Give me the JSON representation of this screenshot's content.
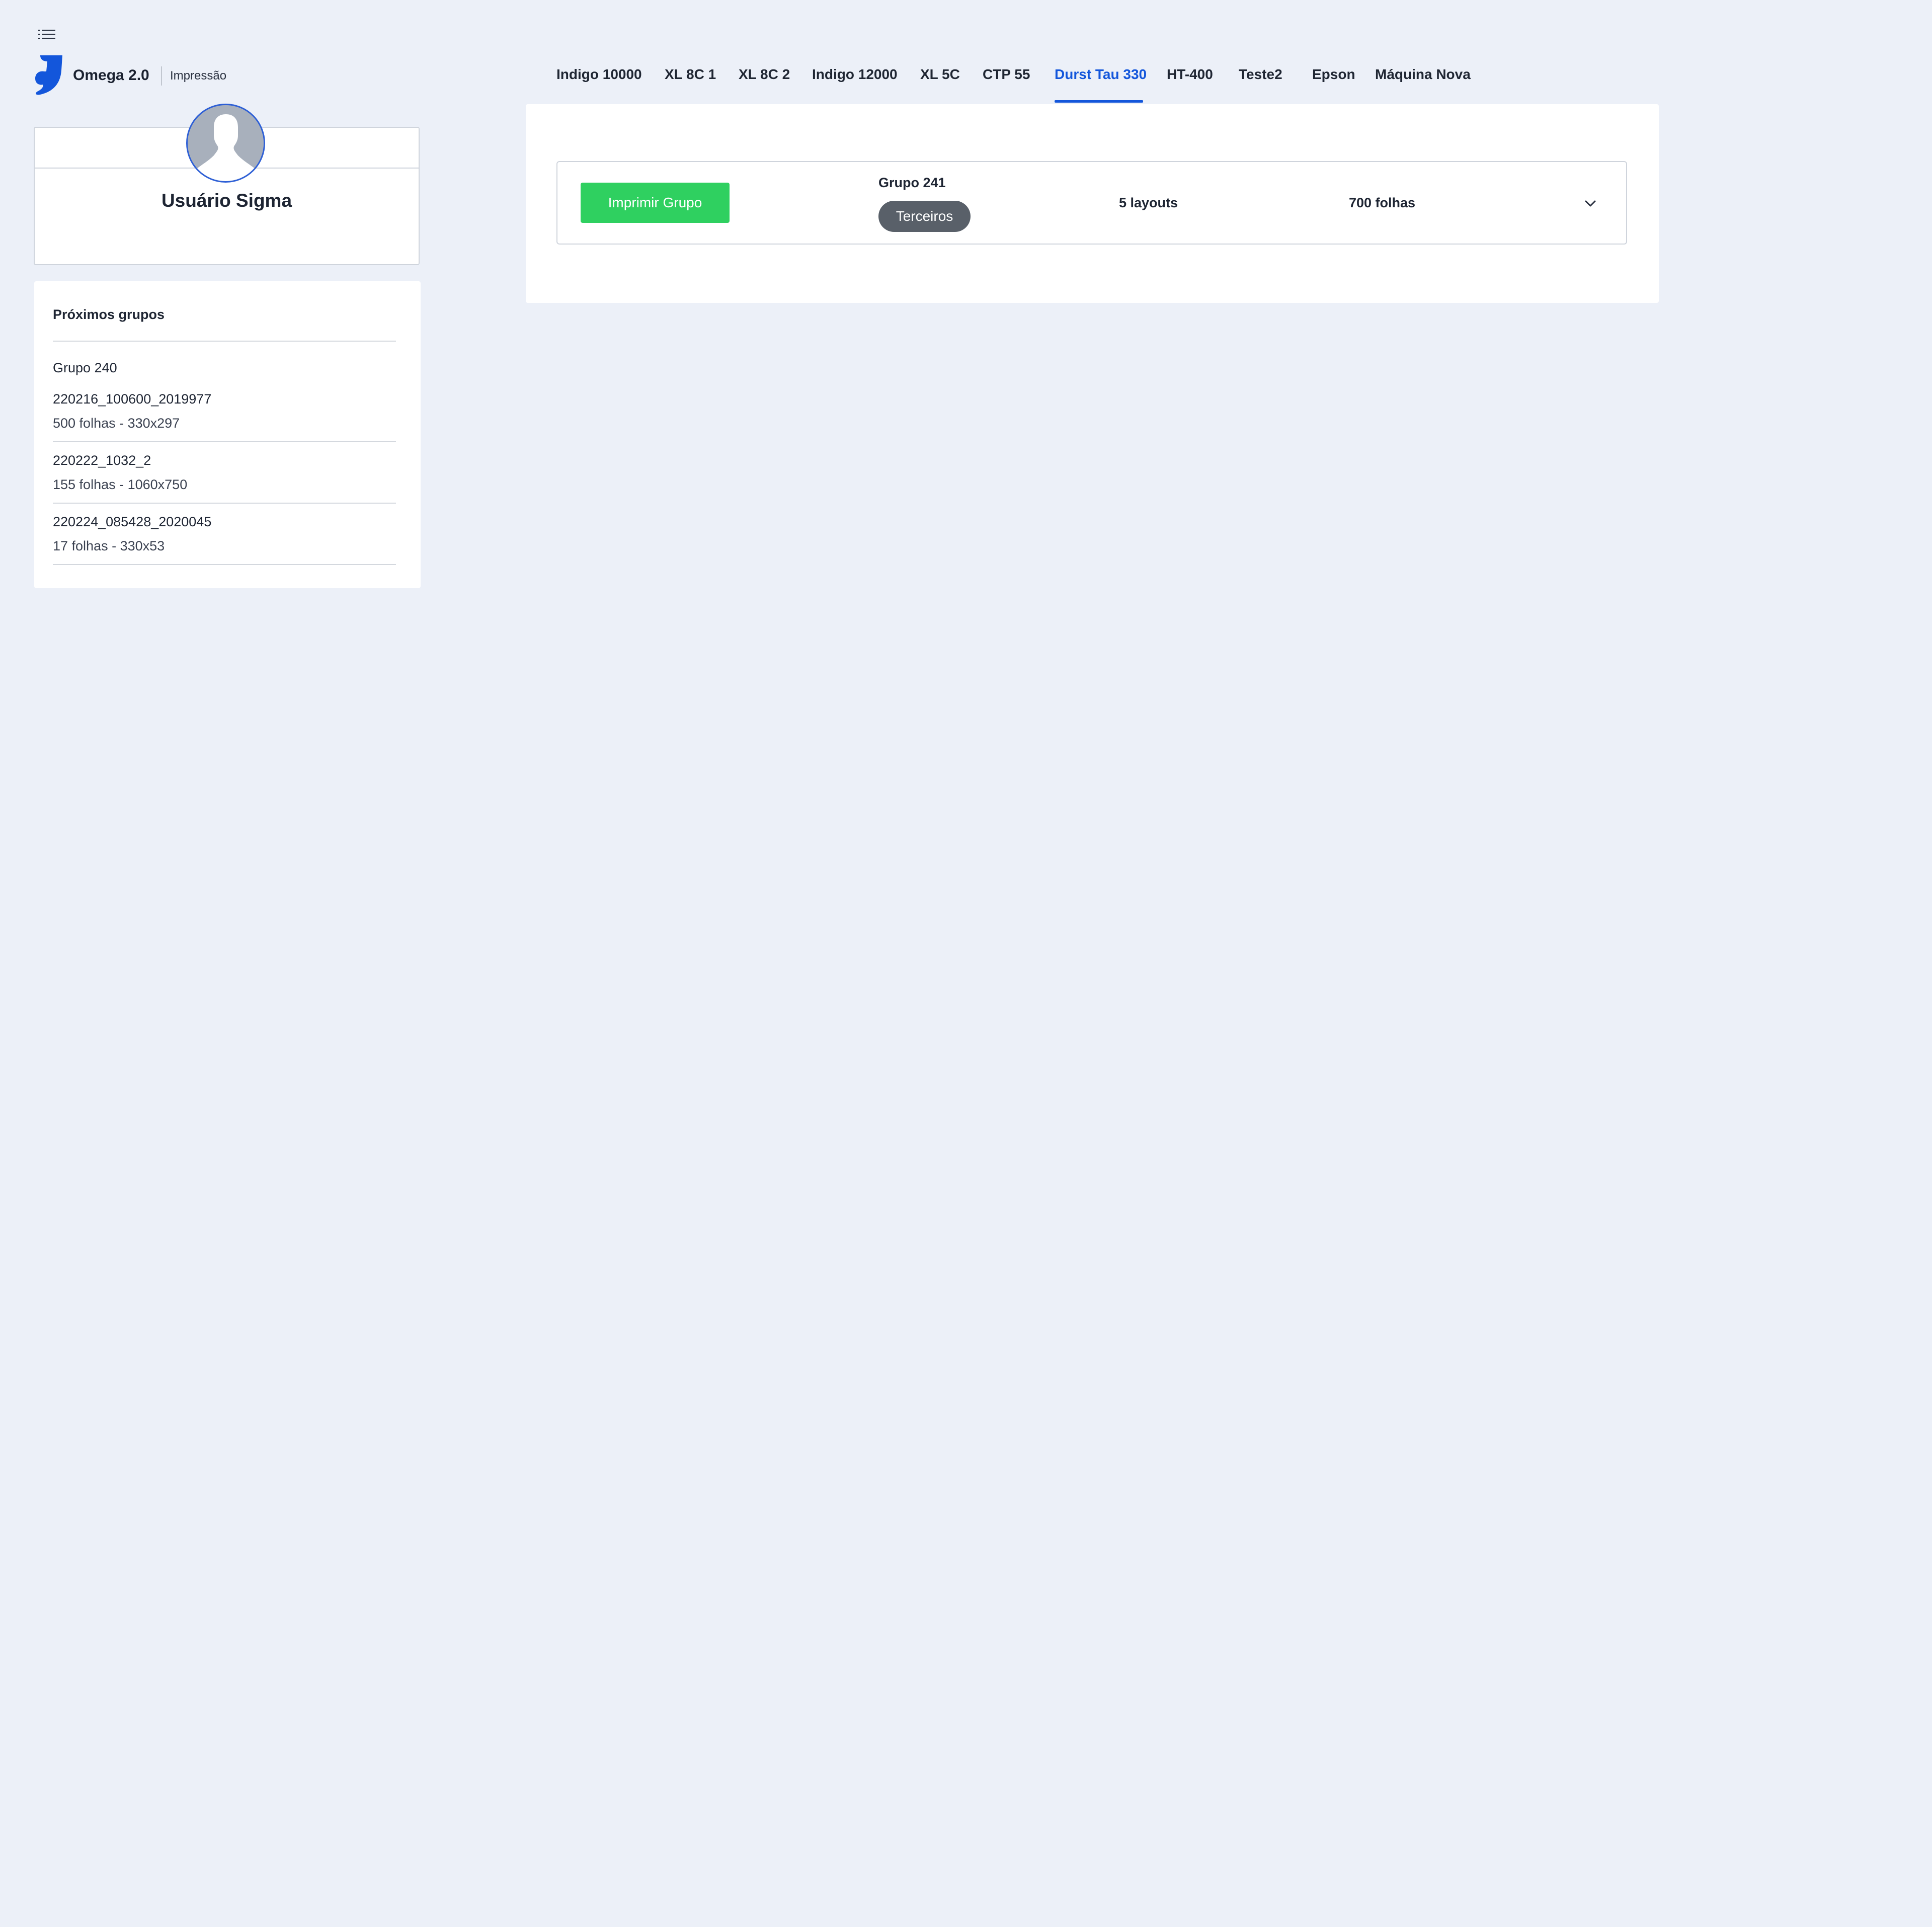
{
  "header": {
    "brand": "Omega 2.0",
    "module": "Impressão",
    "brand_color": "#1356db",
    "menu_icon": "menu-icon"
  },
  "tabs": [
    {
      "label": "Indigo 10000",
      "active": false
    },
    {
      "label": "XL 8C 1",
      "active": false
    },
    {
      "label": "XL 8C 2",
      "active": false
    },
    {
      "label": "Indigo 12000",
      "active": false
    },
    {
      "label": "XL 5C",
      "active": false
    },
    {
      "label": "CTP 55",
      "active": false
    },
    {
      "label": "Durst Tau 330",
      "active": true
    },
    {
      "label": "HT-400",
      "active": false
    },
    {
      "label": "Teste2",
      "active": false
    },
    {
      "label": "Epson",
      "active": false
    },
    {
      "label": "Máquina Nova",
      "active": false
    }
  ],
  "profile": {
    "name": "Usuário Sigma",
    "avatar_icon": "user-silhouette-icon"
  },
  "next_groups": {
    "title": "Próximos grupos",
    "group_name": "Grupo 240",
    "jobs": [
      {
        "name": "220216_100600_2019977",
        "details": "500 folhas - 330x297"
      },
      {
        "name": "220222_1032_2",
        "details": "155 folhas - 1060x750"
      },
      {
        "name": "220224_085428_2020045",
        "details": "17 folhas - 330x53"
      }
    ]
  },
  "current_group": {
    "print_button": "Imprimir Grupo",
    "name": "Grupo 241",
    "badge": "Terceiros",
    "layouts": "5 layouts",
    "sheets": "700 folhas",
    "expand_icon": "chevron-down-icon",
    "print_button_color": "#2fd060"
  }
}
